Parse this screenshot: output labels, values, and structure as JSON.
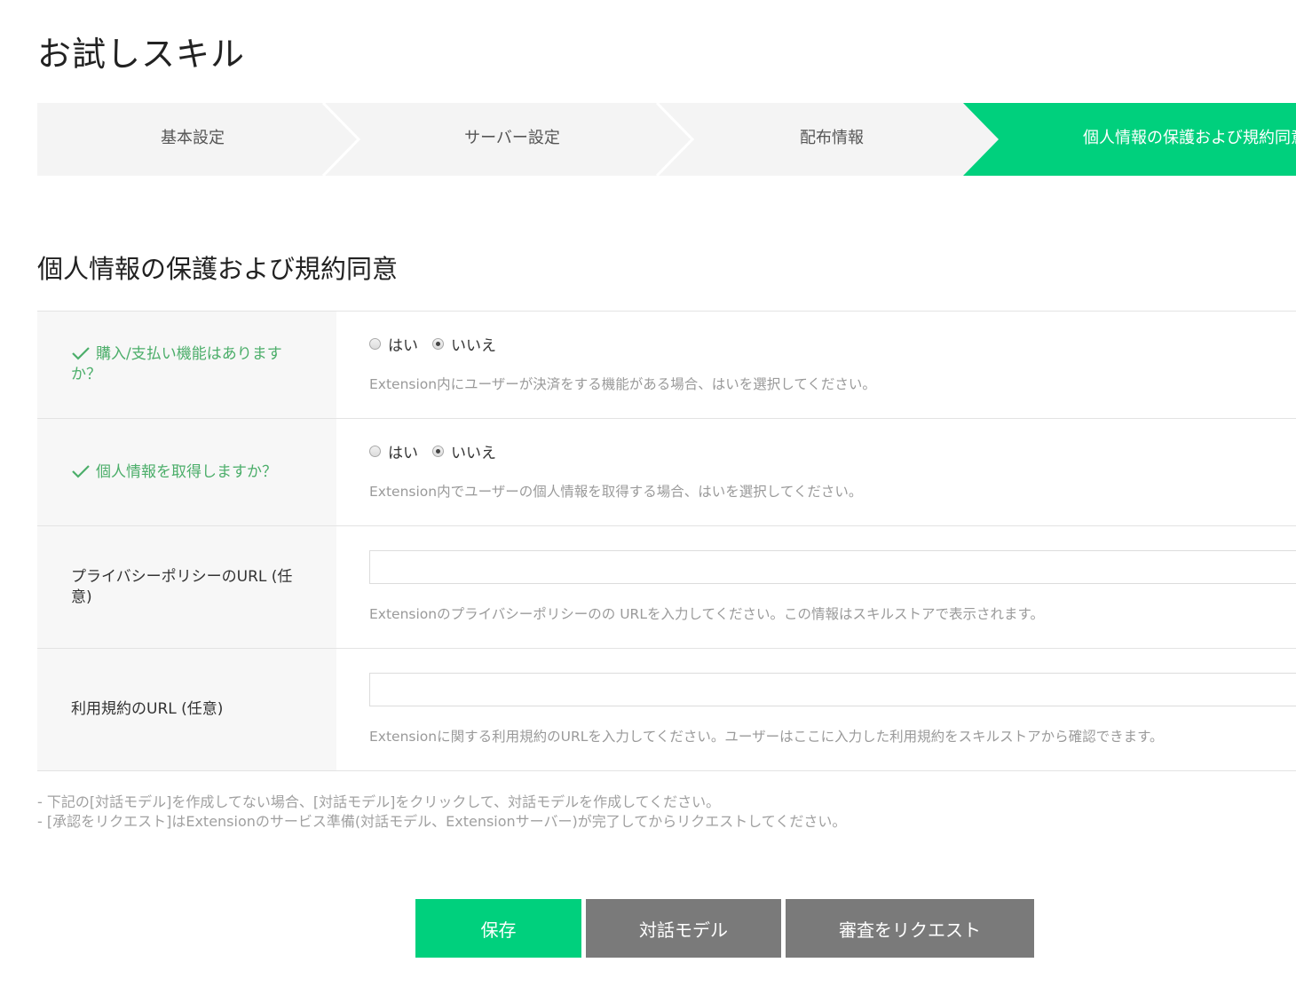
{
  "page": {
    "title": "お試しスキル"
  },
  "stepper": {
    "steps": [
      {
        "label": "基本設定"
      },
      {
        "label": "サーバー設定"
      },
      {
        "label": "配布情報"
      },
      {
        "label": "個人情報の保護および規約同意"
      }
    ],
    "active_index": 3,
    "colors": {
      "inactive": "#f4f4f4",
      "active": "#00d07d",
      "divider": "#ffffff"
    }
  },
  "section": {
    "title": "個人情報の保護および規約同意"
  },
  "form": {
    "payment": {
      "label": "購入/支払い機能はありますか？",
      "options": [
        "はい",
        "いいえ"
      ],
      "selected": "いいえ",
      "hint": "Extension内にユーザーが決済をする機能がある場合、はいを選択してください。"
    },
    "personal_info": {
      "label": "個人情報を取得しますか？",
      "options": [
        "はい",
        "いいえ"
      ],
      "selected": "いいえ",
      "hint": "Extension内でユーザーの個人情報を取得する場合、はいを選択してください。"
    },
    "privacy_url": {
      "label": "プライバシーポリシーのURL (任意)",
      "value": "",
      "hint": "Extensionのプライバシーポリシーのの URLを入力してください。この情報はスキルストアで表示されます。"
    },
    "terms_url": {
      "label": "利用規約のURL (任意)",
      "value": "",
      "hint": "Extensionに関する利用規約のURLを入力してください。ユーザーはここに入力した利用規約をスキルストアから確認できます。"
    }
  },
  "notes": [
    "- 下記の[対話モデル]を作成してない場合、[対話モデル]をクリックして、対話モデルを作成してください。",
    "- [承認をリクエスト]はExtensionのサービス準備(対話モデル、Extensionサーバー)が完了してからリクエストしてください。"
  ],
  "actions": {
    "save_label": "保存",
    "dialog_model_label": "対話モデル",
    "request_review_label": "審査をリクエスト"
  },
  "colors": {
    "accent": "#00d07d",
    "check": "#4cae6a",
    "hint": "#9a9a9a",
    "gray_button": "#7a7a7a"
  }
}
